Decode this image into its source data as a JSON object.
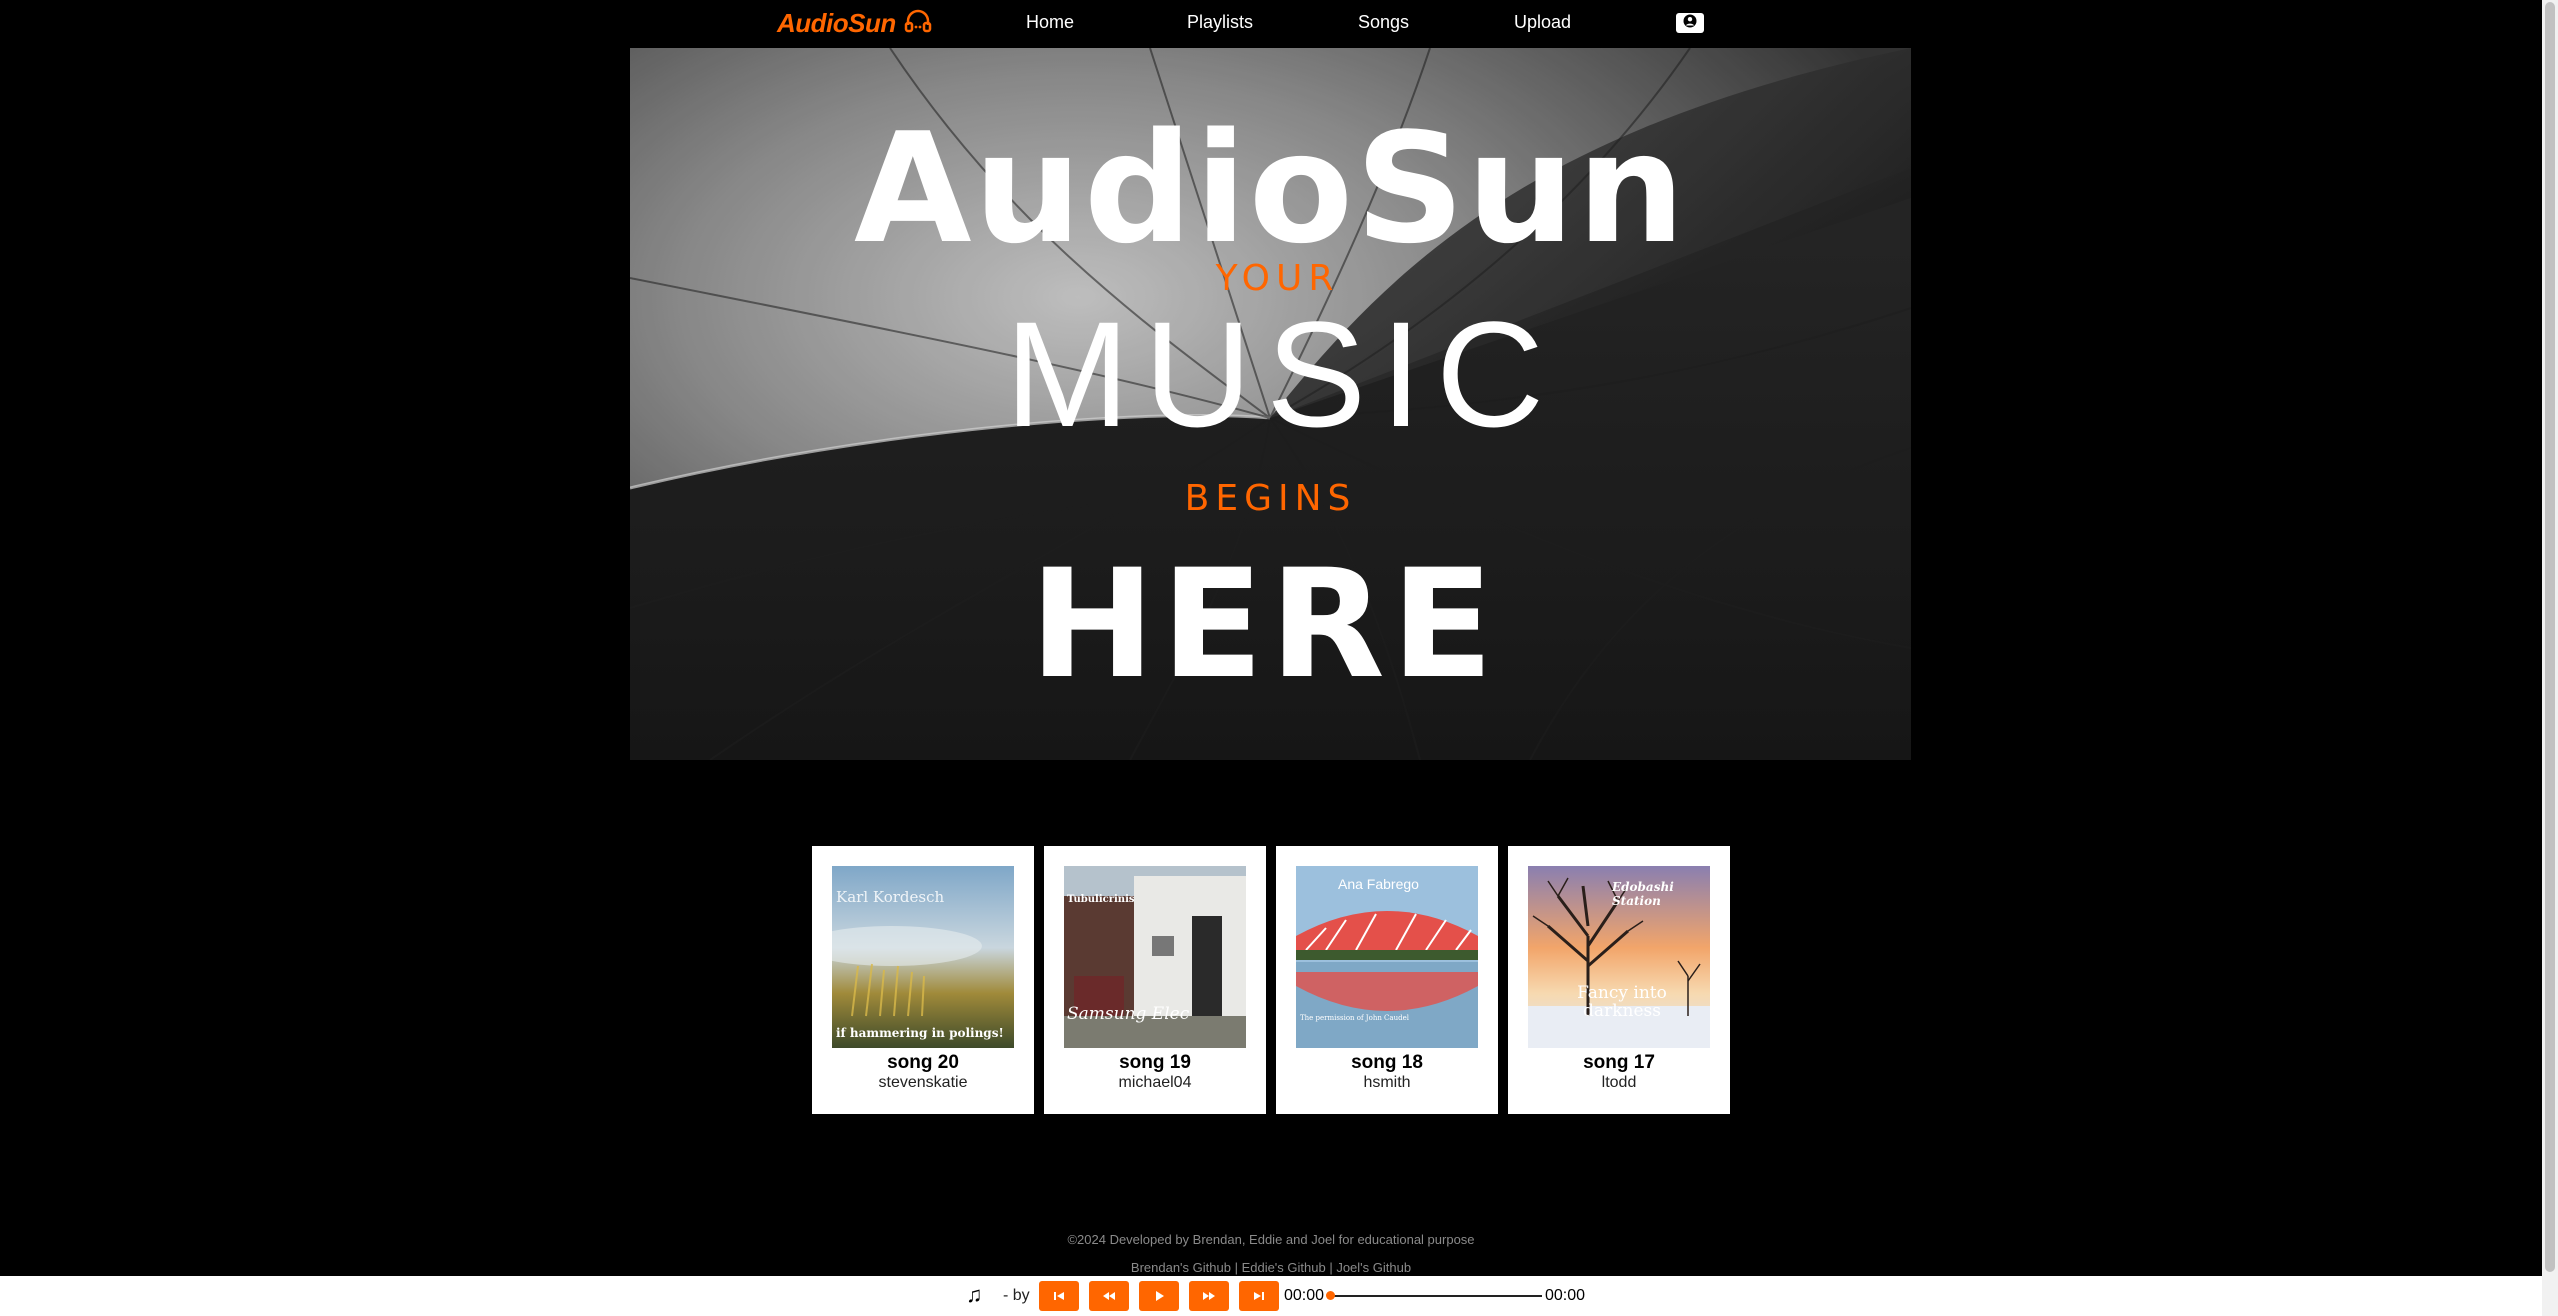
{
  "nav": {
    "brand": "AudioSun",
    "links": [
      "Home",
      "Playlists",
      "Songs",
      "Upload"
    ]
  },
  "hero": {
    "line1": "AudioSun",
    "line2": "YOUR",
    "line3": "MUSIC",
    "line4": "BEGINS",
    "line5": "HERE"
  },
  "songs": [
    {
      "title": "song 20",
      "artist": "stevenskatie",
      "cover_top": "Karl Kordesch",
      "cover_bottom": "if hammering in polings!"
    },
    {
      "title": "song 19",
      "artist": "michael04",
      "cover_top": "Tubulicrinis",
      "cover_bottom": "Samsung Elec"
    },
    {
      "title": "song 18",
      "artist": "hsmith",
      "cover_top": "Ana Fabrego",
      "cover_bottom": "The permission of John Caudel"
    },
    {
      "title": "song 17",
      "artist": "ltodd",
      "cover_top": "Edobashi Station",
      "cover_bottom": "Fancy into darkness"
    }
  ],
  "footer": {
    "copyright": "©2024 Developed by Brendan, Eddie and Joel for educational purpose",
    "links": [
      "Brendan's Github",
      "Eddie's Github",
      "Joel's Github"
    ],
    "separator": " | "
  },
  "player": {
    "by_label": "- by",
    "current_time": "00:00",
    "total_time": "00:00",
    "progress": 0
  },
  "colors": {
    "accent": "#ff6600",
    "background": "#000000"
  }
}
